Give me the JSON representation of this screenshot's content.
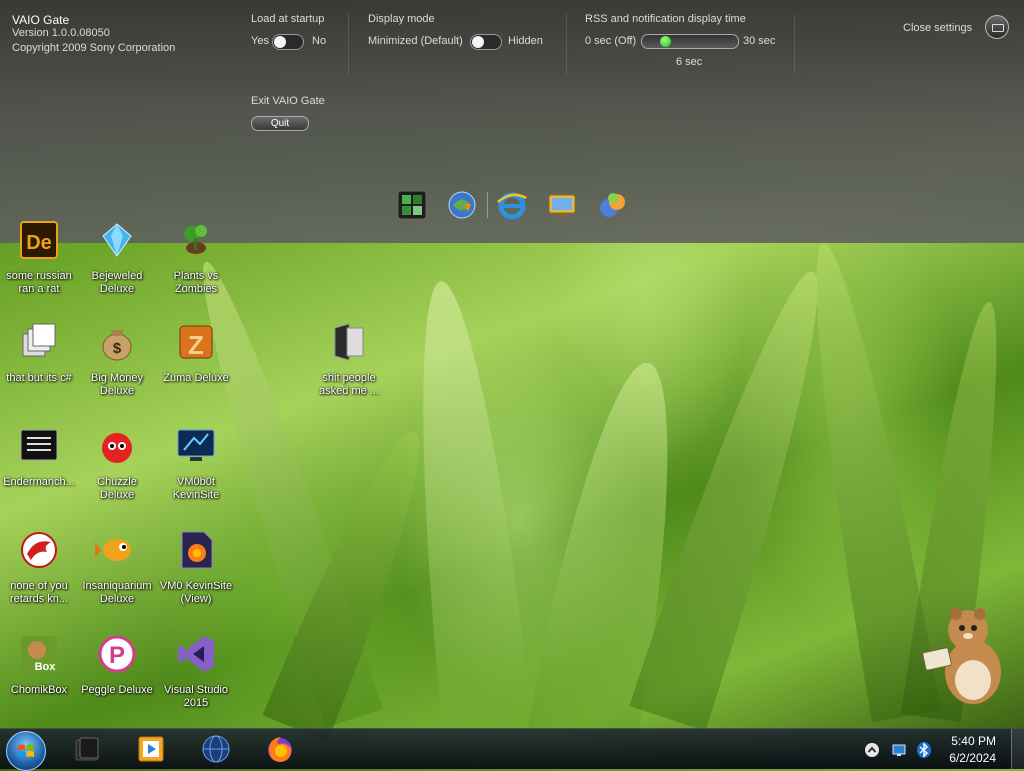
{
  "gate": {
    "app_name": "VAIO Gate",
    "version": "Version 1.0.0.08050",
    "copyright": "Copyright 2009 Sony Corporation",
    "load_at_startup": {
      "title": "Load at startup",
      "on": "Yes",
      "off": "No",
      "state": "Yes"
    },
    "display_mode": {
      "title": "Display mode",
      "left": "Minimized (Default)",
      "right": "Hidden",
      "state": "Minimized (Default)"
    },
    "rss": {
      "title": "RSS and notification display time",
      "min_label": "0 sec (Off)",
      "max_label": "30 sec",
      "value_label": "6 sec",
      "value": 6,
      "min": 0,
      "max": 30
    },
    "exit": {
      "title": "Exit VAIO Gate",
      "quit_label": "Quit"
    },
    "close_settings": "Close settings",
    "dock_icons": [
      "media-gallery-icon",
      "browser-download-icon",
      "internet-explorer-icon",
      "monitor-app-icon",
      "help-sphere-icon"
    ]
  },
  "desktop": {
    "icons": [
      {
        "name": "desktop-icon-some-russian",
        "label": "some russian\nran a rat",
        "icon": "dreamweaver-icon"
      },
      {
        "name": "desktop-icon-bejeweled",
        "label": "Bejeweled\nDeluxe",
        "icon": "gem-icon"
      },
      {
        "name": "desktop-icon-plants-vs-zombies",
        "label": "Plants vs\nZombies",
        "icon": "plant-icon"
      },
      {
        "name": "desktop-icon-that-but-its-csharp",
        "label": "that but its c#",
        "icon": "windows-stack-icon"
      },
      {
        "name": "desktop-icon-big-money",
        "label": "Big Money\nDeluxe",
        "icon": "money-bag-icon"
      },
      {
        "name": "desktop-icon-zuma",
        "label": "Zuma Deluxe",
        "icon": "zuma-icon"
      },
      {
        "name": "desktop-icon-shit-people",
        "label": "shit people\nasked me ...",
        "icon": "folder-icon"
      },
      {
        "name": "desktop-icon-endermanch",
        "label": "Endermanch...",
        "icon": "terminal-icon"
      },
      {
        "name": "desktop-icon-chuzzle",
        "label": "Chuzzle\nDeluxe",
        "icon": "chuzzle-icon"
      },
      {
        "name": "desktop-icon-vm0b0t",
        "label": "VM0b0t\nKevinSite",
        "icon": "monitor-icon"
      },
      {
        "name": "desktop-icon-none-of-you",
        "label": "none of you\nretards kn...",
        "icon": "red-dragon-icon"
      },
      {
        "name": "desktop-icon-insaniquarium",
        "label": "Insaniquarium\nDeluxe",
        "icon": "fish-icon"
      },
      {
        "name": "desktop-icon-vm0-kevinsite",
        "label": "VM0 KevinSite\n(View)",
        "icon": "firefox-file-icon"
      },
      {
        "name": "desktop-icon-chomikbox",
        "label": "ChomikBox",
        "icon": "hamster-box-icon"
      },
      {
        "name": "desktop-icon-peggle",
        "label": "Peggle Deluxe",
        "icon": "peggle-icon"
      },
      {
        "name": "desktop-icon-visual-studio",
        "label": "Visual Studio\n2015",
        "icon": "visual-studio-icon"
      }
    ]
  },
  "taskbar": {
    "pinned": [
      "explorer-icon",
      "media-player-icon",
      "globe-icon",
      "firefox-icon"
    ],
    "time": "5:40 PM",
    "date": "6/2/2024"
  }
}
